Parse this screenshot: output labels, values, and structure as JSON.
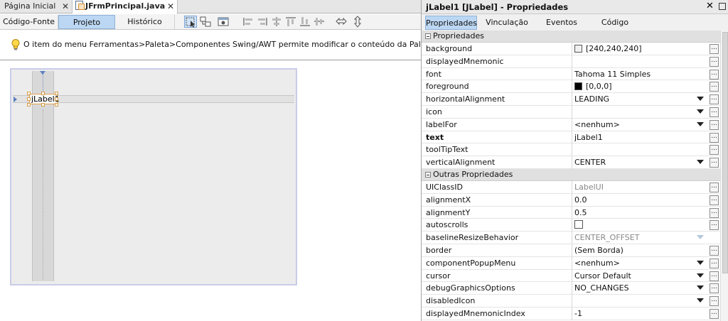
{
  "editor": {
    "tabs": [
      {
        "label": "Página Inicial"
      },
      {
        "label": "JFrmPrincipal.java"
      }
    ],
    "views": [
      "Código-Fonte",
      "Projeto",
      "Histórico"
    ],
    "hint": "O item do menu Ferramentas>Paleta>Componentes Swing/AWT permite modificar o conteúdo da Paleta.",
    "component_label": "jLabel1"
  },
  "properties_panel": {
    "title": "jLabel1 [JLabel] - Propriedades",
    "tabs": [
      "Propriedades",
      "Vinculação",
      "Eventos",
      "Código"
    ],
    "sections": [
      {
        "title": "Propriedades",
        "rows": [
          {
            "name": "background",
            "value": "[240,240,240]",
            "swatch": "#f0f0f0",
            "button": true
          },
          {
            "name": "displayedMnemonic",
            "value": "",
            "button": true
          },
          {
            "name": "font",
            "value": "Tahoma 11 Simples",
            "button": true
          },
          {
            "name": "foreground",
            "value": "[0,0,0]",
            "swatch": "#000000",
            "button": true
          },
          {
            "name": "horizontalAlignment",
            "value": "LEADING",
            "dropdown": true,
            "button": true
          },
          {
            "name": "icon",
            "value": "",
            "dropdown": true,
            "button": true
          },
          {
            "name": "labelFor",
            "value": "<nenhum>",
            "dropdown": true,
            "button": true
          },
          {
            "name": "text",
            "value": "jLabel1",
            "bold": true,
            "button": true
          },
          {
            "name": "toolTipText",
            "value": "",
            "button": true
          },
          {
            "name": "verticalAlignment",
            "value": "CENTER",
            "dropdown": true,
            "button": true
          }
        ]
      },
      {
        "title": "Outras Propriedades",
        "rows": [
          {
            "name": "UIClassID",
            "value": "LabelUI",
            "gray": true,
            "button": true
          },
          {
            "name": "alignmentX",
            "value": "0.0",
            "button": true
          },
          {
            "name": "alignmentY",
            "value": "0.5",
            "button": true
          },
          {
            "name": "autoscrolls",
            "value": "",
            "checkbox": true,
            "button": true
          },
          {
            "name": "baselineResizeBehavior",
            "value": "CENTER_OFFSET",
            "gray": true,
            "dropdown_gray": true
          },
          {
            "name": "border",
            "value": "(Sem Borda)",
            "button": true
          },
          {
            "name": "componentPopupMenu",
            "value": "<nenhum>",
            "dropdown": true,
            "button": true
          },
          {
            "name": "cursor",
            "value": "Cursor Default",
            "dropdown": true,
            "button": true
          },
          {
            "name": "debugGraphicsOptions",
            "value": "NO_CHANGES",
            "dropdown": true,
            "button": true
          },
          {
            "name": "disabledIcon",
            "value": "",
            "dropdown": true,
            "button": true
          },
          {
            "name": "displayedMnemonicIndex",
            "value": "-1",
            "button": true
          }
        ]
      }
    ],
    "button_label": "..."
  }
}
